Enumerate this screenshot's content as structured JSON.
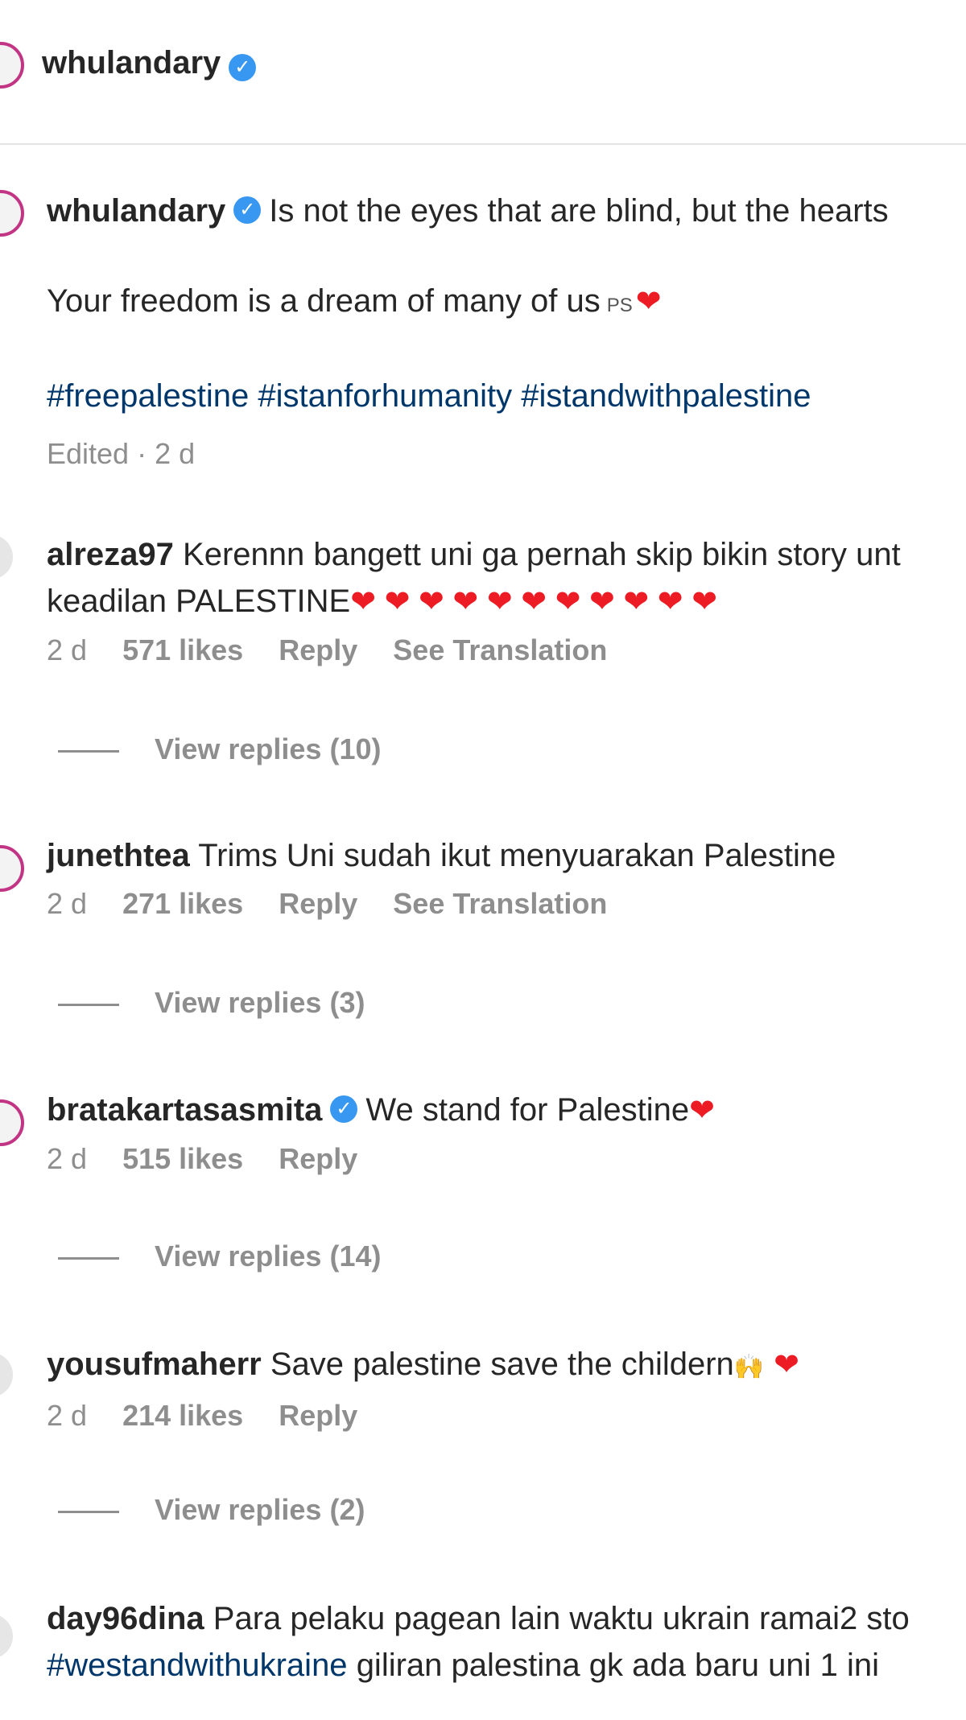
{
  "header": {
    "username": "whulandary"
  },
  "caption": {
    "username": "whulandary",
    "line1": "Is not the eyes that are blind, but the hearts",
    "line2": "Your freedom is a dream of many of us",
    "line2_flag": "PS",
    "hashtags": [
      "#freepalestine",
      "#istanforhumanity",
      "#istandwithpalestine"
    ],
    "meta": "Edited · 2 d"
  },
  "comments": [
    {
      "username": "alreza97",
      "text_line1": "Kerennn bangett uni ga pernah skip bikin story unt",
      "text_line2": "keadilan PALESTINE",
      "hearts": "❤ ❤ ❤ ❤ ❤ ❤ ❤ ❤ ❤ ❤ ❤",
      "time": "2 d",
      "likes": "571 likes",
      "reply": "Reply",
      "translate": "See Translation",
      "view_replies": "View replies (10)"
    },
    {
      "username": "junethtea",
      "text_line1": "Trims Uni sudah ikut menyuarakan Palestine",
      "time": "2 d",
      "likes": "271 likes",
      "reply": "Reply",
      "translate": "See Translation",
      "view_replies": "View replies (3)"
    },
    {
      "username": "bratakartasasmita",
      "text_line1": "We stand for Palestine",
      "hearts": "❤",
      "time": "2 d",
      "likes": "515 likes",
      "reply": "Reply",
      "view_replies": "View replies (14)"
    },
    {
      "username": "yousufmaherr",
      "text_line1": "Save palestine save the childern",
      "emoji": "🙌",
      "hearts": "❤",
      "time": "2 d",
      "likes": "214 likes",
      "reply": "Reply",
      "view_replies": "View replies (2)"
    },
    {
      "username": "day96dina",
      "text_line1": "Para pelaku pagean lain waktu ukrain ramai2 sto",
      "hashtag_line2": "#westandwithukraine",
      "text_line2": "giliran palestina gk ada baru uni 1 ini"
    }
  ],
  "colors": {
    "verified": "#3897f0",
    "hashtag": "#00376b",
    "meta": "#8e8e8e",
    "heart": "#ed1c24",
    "avatar_ring": "#c13584"
  }
}
